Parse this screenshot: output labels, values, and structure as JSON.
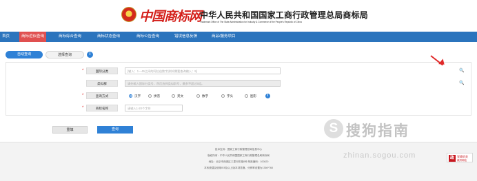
{
  "header": {
    "logo_script": "中国商标网",
    "org_title": "中华人民共和国国家工商行政管理总局商标局",
    "org_subtitle": "Trademark Office of The State Administration for Industry & Commerce of the People's Republic of China"
  },
  "nav": {
    "items": [
      {
        "label": "首页"
      },
      {
        "label": "商标近似查询"
      },
      {
        "label": "商标综合查询"
      },
      {
        "label": "商标状态查询"
      },
      {
        "label": "商标公告查询"
      },
      {
        "label": "错误信息反馈"
      },
      {
        "label": "商品/服务项目"
      }
    ],
    "active_index": 1
  },
  "mode_tabs": {
    "auto": "自动查询",
    "select": "选择查询",
    "info_glyph": "i"
  },
  "form": {
    "rows": [
      {
        "label": "国际分类",
        "required": true,
        "placeholder": "[输入：1－45之间的阿拉伯数字]例如需要查询输入：9]"
      },
      {
        "label": "类似群",
        "required": false,
        "placeholder": "请先输入国际分类号，然后选择类似群号，最多不超过5组。"
      },
      {
        "label": "查询方式",
        "required": true
      },
      {
        "label": "商标名称",
        "required": true,
        "placeholder": "请输入1-20个字符"
      }
    ],
    "search_methods": [
      "汉字",
      "拼音",
      "英文",
      "数字",
      "字头",
      "图形"
    ],
    "selected_method": "汉字"
  },
  "buttons": {
    "reset": "重填",
    "query": "查询"
  },
  "watermark": {
    "logo_glyph": "S",
    "brand": "搜狗指南",
    "url": "zhinan.sogou.com"
  },
  "footer": {
    "lines": [
      "技术支持：国家工商行政管理总局信息中心",
      "版权所有：中华人民共和国国家工商行政管理总局商标局",
      "地址：北京市西城区三里河东路8号  邮政编码：100820",
      "本系统建议使用IE8及以上版本浏览器，分辨率设置为1366*768"
    ]
  },
  "badge": {
    "mark": "政",
    "line1": "党政机关",
    "line2": "政府网站"
  },
  "colors": {
    "nav_bg": "#2b74bd",
    "nav_active": "#e05050",
    "primary_button": "#2f81d6",
    "arrow": "#e02a2a",
    "logo_red": "#d4201b"
  }
}
